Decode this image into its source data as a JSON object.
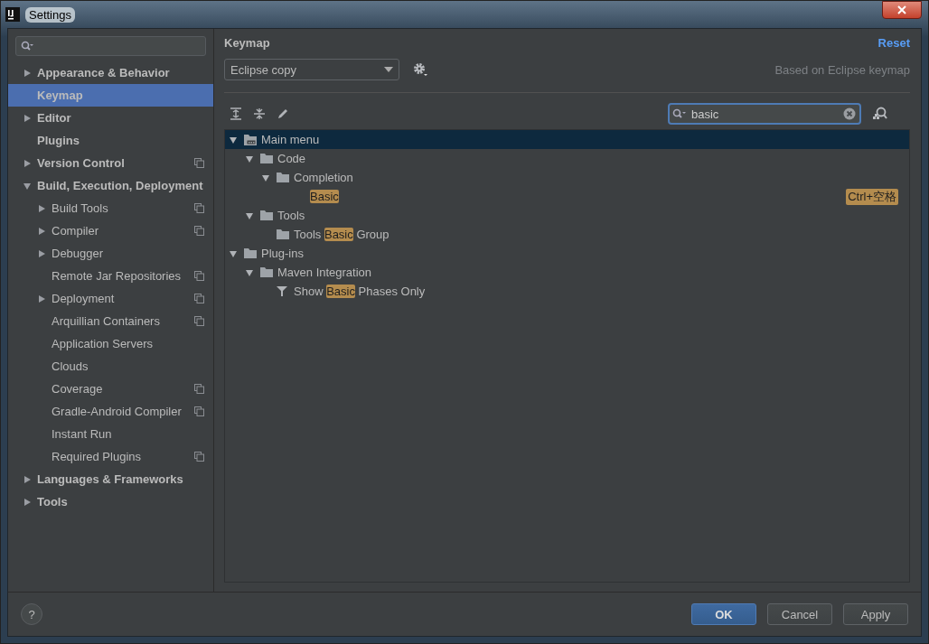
{
  "window": {
    "title": "Settings"
  },
  "sidebar": {
    "items": [
      {
        "label": "Appearance & Behavior",
        "expanded": false,
        "selected": false,
        "project_scoped": false
      },
      {
        "label": "Keymap",
        "selected": true,
        "project_scoped": false
      },
      {
        "label": "Editor",
        "expanded": false,
        "selected": false,
        "project_scoped": false
      },
      {
        "label": "Plugins",
        "selected": false,
        "project_scoped": false
      },
      {
        "label": "Version Control",
        "expanded": false,
        "selected": false,
        "project_scoped": true
      },
      {
        "label": "Build, Execution, Deployment",
        "expanded": true,
        "selected": false,
        "project_scoped": false,
        "children": [
          {
            "label": "Build Tools",
            "expanded": false,
            "selected": false,
            "project_scoped": true
          },
          {
            "label": "Compiler",
            "expanded": false,
            "selected": false,
            "project_scoped": true
          },
          {
            "label": "Debugger",
            "expanded": false,
            "selected": false,
            "project_scoped": false
          },
          {
            "label": "Remote Jar Repositories",
            "selected": false,
            "project_scoped": true
          },
          {
            "label": "Deployment",
            "expanded": false,
            "selected": false,
            "project_scoped": true
          },
          {
            "label": "Arquillian Containers",
            "selected": false,
            "project_scoped": true
          },
          {
            "label": "Application Servers",
            "selected": false,
            "project_scoped": false
          },
          {
            "label": "Clouds",
            "selected": false,
            "project_scoped": false
          },
          {
            "label": "Coverage",
            "selected": false,
            "project_scoped": true
          },
          {
            "label": "Gradle-Android Compiler",
            "selected": false,
            "project_scoped": true
          },
          {
            "label": "Instant Run",
            "selected": false,
            "project_scoped": false
          },
          {
            "label": "Required Plugins",
            "selected": false,
            "project_scoped": true
          }
        ]
      },
      {
        "label": "Languages & Frameworks",
        "expanded": false,
        "selected": false,
        "project_scoped": false
      },
      {
        "label": "Tools",
        "expanded": false,
        "selected": false,
        "project_scoped": false
      }
    ]
  },
  "panel": {
    "title": "Keymap",
    "reset_link": "Reset",
    "keymap_select": {
      "value": "Eclipse copy"
    },
    "based_on": "Based on Eclipse keymap",
    "search": {
      "value": "basic"
    },
    "tree": [
      {
        "kind": "menu-folder",
        "parts": [
          {
            "text": "Main menu",
            "match": false
          }
        ],
        "expanded": true,
        "selected": true,
        "children": [
          {
            "kind": "folder",
            "parts": [
              {
                "text": "Code",
                "match": false
              }
            ],
            "expanded": true,
            "selected": false,
            "children": [
              {
                "kind": "folder",
                "parts": [
                  {
                    "text": "Completion",
                    "match": false
                  }
                ],
                "expanded": true,
                "selected": false,
                "children": [
                  {
                    "parts": [
                      {
                        "text": "Basic",
                        "match": true
                      }
                    ],
                    "selected": false,
                    "shortcut": "Ctrl+空格"
                  }
                ]
              }
            ]
          },
          {
            "kind": "folder",
            "parts": [
              {
                "text": "Tools",
                "match": false
              }
            ],
            "expanded": true,
            "selected": false,
            "children": [
              {
                "kind": "folder",
                "parts": [
                  {
                    "text": "Tools ",
                    "match": false
                  },
                  {
                    "text": "Basic",
                    "match": true
                  },
                  {
                    "text": " Group",
                    "match": false
                  }
                ],
                "selected": false
              }
            ]
          }
        ]
      },
      {
        "kind": "folder",
        "parts": [
          {
            "text": "Plug-ins",
            "match": false
          }
        ],
        "expanded": true,
        "selected": false,
        "children": [
          {
            "kind": "folder",
            "parts": [
              {
                "text": "Maven Integration",
                "match": false
              }
            ],
            "expanded": true,
            "selected": false,
            "children": [
              {
                "kind": "filter",
                "parts": [
                  {
                    "text": "Show ",
                    "match": false
                  },
                  {
                    "text": "Basic",
                    "match": true
                  },
                  {
                    "text": " Phases Only",
                    "match": false
                  }
                ],
                "selected": false
              }
            ]
          }
        ]
      }
    ]
  },
  "footer": {
    "help": "?",
    "buttons": [
      {
        "label": "OK",
        "default": true
      },
      {
        "label": "Cancel",
        "default": false
      },
      {
        "label": "Apply",
        "default": false
      }
    ]
  }
}
